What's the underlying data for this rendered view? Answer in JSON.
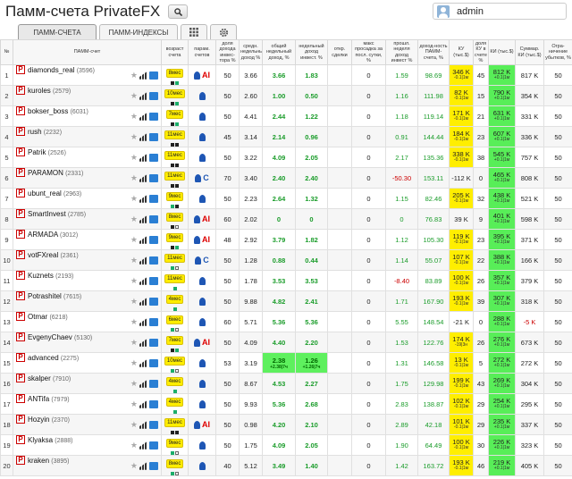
{
  "header": {
    "title": "Памм-счета PrivateFX",
    "user": "admin"
  },
  "tabs": [
    {
      "label": "ПАММ-СЧЕТА",
      "active": true
    },
    {
      "label": "ПАММ-ИНДЕКСЫ",
      "active": false
    }
  ],
  "columns": [
    "№",
    "ПАММ-счет",
    "возраст счета",
    "парам. счетов",
    "доля дохода инвес-тора %",
    "средн. недельный доход %",
    "общий недельный доход, %",
    "недельный доход инвест. %",
    "откр. сделки",
    "макс просадка за посл. сутки, %",
    "прошл. неделя доход инвест %",
    "доход-ность ПАММ-счета, %",
    "КУ (тыс.$)",
    "доля КУ в счете %",
    "КИ (тыс.$)",
    "Суммар. КИ (тыс.$)",
    "Огра-ничение убытков, %"
  ],
  "rows": [
    {
      "n": "1",
      "name": "diamonds_real",
      "id": "(3596)",
      "age": "8мес",
      "sq": [
        "k",
        "g"
      ],
      "ai": "AI",
      "share": "50",
      "avg": "3.66",
      "tot": "3.66",
      "tot_sub": "",
      "inv": "1.83",
      "inv_sub": "",
      "open": "",
      "dd": "0",
      "prev": "1.59",
      "yld": "98.69",
      "ku": "346 K",
      "ku_s": "-0.1|1м",
      "kud": "45",
      "ki": "812 K",
      "ki_s": "+0.1|1м",
      "sum": "817 K",
      "lim": "50"
    },
    {
      "n": "2",
      "name": "kuroles",
      "id": "(2579)",
      "age": "10мес",
      "sq": [
        "k",
        "g"
      ],
      "ai": "",
      "share": "50",
      "avg": "2.60",
      "tot": "1.00",
      "tot_sub": "",
      "inv": "0.50",
      "inv_sub": "",
      "open": "",
      "dd": "0",
      "prev": "1.16",
      "yld": "111.98",
      "ku": "82 K",
      "ku_s": "-0.1|1м",
      "kud": "15",
      "ki": "790 K",
      "ki_s": "+0.1|1м",
      "sum": "354 K",
      "lim": "50"
    },
    {
      "n": "3",
      "name": "bokser_boss",
      "id": "(6031)",
      "age": "7мес",
      "sq": [
        "k",
        "g"
      ],
      "ai": "",
      "share": "50",
      "avg": "4.41",
      "tot": "2.44",
      "tot_sub": "",
      "inv": "1.22",
      "inv_sub": "",
      "open": "",
      "dd": "0",
      "prev": "1.18",
      "yld": "119.14",
      "ku": "171 K",
      "ku_s": "-0.1|1м",
      "kud": "21",
      "ki": "631 K",
      "ki_s": "+0.1|1м",
      "sum": "331 K",
      "lim": "50"
    },
    {
      "n": "4",
      "name": "rush",
      "id": "(2232)",
      "age": "11мес",
      "sq": [
        "k",
        "k"
      ],
      "ai": "",
      "share": "45",
      "avg": "3.14",
      "tot": "2.14",
      "tot_sub": "",
      "inv": "0.96",
      "inv_sub": "",
      "open": "",
      "dd": "0",
      "prev": "0.91",
      "yld": "144.44",
      "ku": "184 K",
      "ku_s": "-0.1|1м",
      "kud": "23",
      "ki": "607 K",
      "ki_s": "+0.1|1м",
      "sum": "336 K",
      "lim": "50"
    },
    {
      "n": "5",
      "name": "Patrik",
      "id": "(2526)",
      "age": "11мес",
      "sq": [
        "k",
        "k"
      ],
      "ai": "",
      "share": "50",
      "avg": "3.22",
      "tot": "4.09",
      "tot_sub": "",
      "inv": "2.05",
      "inv_sub": "",
      "open": "",
      "dd": "0",
      "prev": "2.17",
      "yld": "135.36",
      "ku": "338 K",
      "ku_s": "-0.1|1м",
      "kud": "38",
      "ki": "545 K",
      "ki_s": "+0.1|1м",
      "sum": "757 K",
      "lim": "50"
    },
    {
      "n": "6",
      "name": "PARAMON",
      "id": "(2331)",
      "age": "11мес",
      "sq": [
        "k",
        "k"
      ],
      "ai": "C",
      "share": "70",
      "avg": "3.40",
      "tot": "2.40",
      "tot_sub": "",
      "inv": "2.40",
      "inv_sub": "",
      "open": "",
      "dd": "0",
      "prev": "-50.30",
      "yld": "153.11",
      "ku": "-112 K",
      "ku_s": "",
      "kud": "0",
      "ki": "465 K",
      "ki_s": "+0.1|1м",
      "sum": "808 K",
      "lim": "50"
    },
    {
      "n": "7",
      "name": "ubunt_real",
      "id": "(2963)",
      "age": "9мес",
      "sq": [
        "g",
        "k"
      ],
      "ai": "",
      "share": "50",
      "avg": "2.23",
      "tot": "2.64",
      "tot_sub": "",
      "inv": "1.32",
      "inv_sub": "",
      "open": "",
      "dd": "0",
      "prev": "1.15",
      "yld": "82.46",
      "ku": "205 K",
      "ku_s": "-0.1|1м",
      "kud": "32",
      "ki": "438 K",
      "ki_s": "+0.1|1м",
      "sum": "521 K",
      "lim": "50"
    },
    {
      "n": "8",
      "name": "SmartInvest",
      "id": "(2785)",
      "age": "8мес",
      "sq": [
        "k",
        "w"
      ],
      "ai": "AI",
      "share": "60",
      "avg": "2.02",
      "tot": "0",
      "tot_sub": "",
      "inv": "0",
      "inv_sub": "",
      "open": "",
      "dd": "0",
      "prev": "0",
      "yld": "76.83",
      "ku": "39 K",
      "ku_s": "",
      "kud": "9",
      "ki": "401 K",
      "ki_s": "+0.1|1м",
      "sum": "598 K",
      "lim": "50"
    },
    {
      "n": "9",
      "name": "ARMADA",
      "id": "(3012)",
      "age": "9мес",
      "sq": [
        "k",
        "g"
      ],
      "ai": "AI",
      "share": "48",
      "avg": "2.92",
      "tot": "3.79",
      "tot_sub": "",
      "inv": "1.82",
      "inv_sub": "",
      "open": "",
      "dd": "0",
      "prev": "1.12",
      "yld": "105.30",
      "ku": "119 K",
      "ku_s": "-0.1|1м",
      "kud": "23",
      "ki": "395 K",
      "ki_s": "+0.1|1м",
      "sum": "371 K",
      "lim": "50"
    },
    {
      "n": "10",
      "name": "votFXreal",
      "id": "(2361)",
      "age": "11мес",
      "sq": [
        "g",
        "w"
      ],
      "ai": "C",
      "share": "50",
      "avg": "1.28",
      "tot": "0.88",
      "tot_sub": "",
      "inv": "0.44",
      "inv_sub": "",
      "open": "",
      "dd": "0",
      "prev": "1.14",
      "yld": "55.07",
      "ku": "107 K",
      "ku_s": "-0.1|1м",
      "kud": "22",
      "ki": "388 K",
      "ki_s": "+0.1|1м",
      "sum": "166 K",
      "lim": "50"
    },
    {
      "n": "11",
      "name": "Kuznets",
      "id": "(2193)",
      "age": "11мес",
      "sq": [
        "g"
      ],
      "ai": "",
      "share": "50",
      "avg": "1.78",
      "tot": "3.53",
      "tot_sub": "",
      "inv": "3.53",
      "inv_sub": "",
      "open": "",
      "dd": "0",
      "prev": "-8.40",
      "yld": "83.89",
      "ku": "100 K",
      "ku_s": "-0.1|1м",
      "kud": "26",
      "ki": "357 K",
      "ki_s": "+0.1|1м",
      "sum": "379 K",
      "lim": "50"
    },
    {
      "n": "12",
      "name": "Potrashitel",
      "id": "(7615)",
      "age": "4мес",
      "sq": [
        "g"
      ],
      "ai": "",
      "share": "50",
      "avg": "9.88",
      "tot": "4.82",
      "tot_sub": "",
      "inv": "2.41",
      "inv_sub": "",
      "open": "",
      "dd": "0",
      "prev": "1.71",
      "yld": "167.90",
      "ku": "193 K",
      "ku_s": "-0.1|1м",
      "kud": "39",
      "ki": "307 K",
      "ki_s": "+0.1|1м",
      "sum": "318 K",
      "lim": "50"
    },
    {
      "n": "13",
      "name": "Otmar",
      "id": "(6218)",
      "age": "6мес",
      "sq": [
        "g",
        "w"
      ],
      "ai": "",
      "share": "60",
      "avg": "5.71",
      "tot": "5.36",
      "tot_sub": "",
      "inv": "5.36",
      "inv_sub": "",
      "open": "",
      "dd": "0",
      "prev": "5.55",
      "yld": "148.54",
      "ku": "-21 K",
      "ku_s": "",
      "kud": "0",
      "ki": "288 K",
      "ki_s": "+0.1|1м",
      "sum": "-5 K",
      "lim": "50"
    },
    {
      "n": "14",
      "name": "EvgenyChaev",
      "id": "(5130)",
      "age": "7мес",
      "sq": [
        "k",
        "g"
      ],
      "ai": "AI",
      "share": "50",
      "avg": "4.09",
      "tot": "4.40",
      "tot_sub": "",
      "inv": "2.20",
      "inv_sub": "",
      "open": "",
      "dd": "0",
      "prev": "1.53",
      "yld": "122.76",
      "ku": "174 K",
      "ku_s": "-19|3н",
      "kud": "26",
      "ki": "276 K",
      "ki_s": "+0.1|1м",
      "sum": "673 K",
      "lim": "50"
    },
    {
      "n": "15",
      "name": "advanced",
      "id": "(2275)",
      "age": "10мес",
      "sq": [
        "g",
        "w"
      ],
      "ai": "",
      "share": "53",
      "avg": "3.19",
      "tot": "2.38",
      "tot_sub": "+2.38|7ч",
      "inv": "1.26",
      "inv_sub": "+1.26|7ч",
      "open": "",
      "dd": "0",
      "prev": "1.31",
      "yld": "146.58",
      "ku": "13 K",
      "ku_s": "-0.1|1м",
      "kud": "5",
      "ki": "272 K",
      "ki_s": "+0.1|1м",
      "sum": "272 K",
      "lim": "50"
    },
    {
      "n": "16",
      "name": "skalper",
      "id": "(7910)",
      "age": "4мес",
      "sq": [
        "g"
      ],
      "ai": "",
      "share": "50",
      "avg": "8.67",
      "tot": "4.53",
      "tot_sub": "",
      "inv": "2.27",
      "inv_sub": "",
      "open": "",
      "dd": "0",
      "prev": "1.75",
      "yld": "129.98",
      "ku": "199 K",
      "ku_s": "-0.1|1м",
      "kud": "43",
      "ki": "269 K",
      "ki_s": "+0.1|1м",
      "sum": "304 K",
      "lim": "50"
    },
    {
      "n": "17",
      "name": "ANTifa",
      "id": "(7979)",
      "age": "4мес",
      "sq": [
        "g"
      ],
      "ai": "",
      "share": "50",
      "avg": "9.93",
      "tot": "5.36",
      "tot_sub": "",
      "inv": "2.68",
      "inv_sub": "",
      "open": "",
      "dd": "0",
      "prev": "2.83",
      "yld": "138.87",
      "ku": "102 K",
      "ku_s": "-0.1|1м",
      "kud": "29",
      "ki": "254 K",
      "ki_s": "+0.1|1м",
      "sum": "295 K",
      "lim": "50"
    },
    {
      "n": "18",
      "name": "Hozyin",
      "id": "(2370)",
      "age": "11мес",
      "sq": [
        "k",
        "k"
      ],
      "ai": "AI",
      "share": "50",
      "avg": "0.98",
      "tot": "4.20",
      "tot_sub": "",
      "inv": "2.10",
      "inv_sub": "",
      "open": "",
      "dd": "0",
      "prev": "2.89",
      "yld": "42.18",
      "ku": "101 K",
      "ku_s": "-0.1|1м",
      "kud": "29",
      "ki": "235 K",
      "ki_s": "+0.1|1м",
      "sum": "337 K",
      "lim": "50"
    },
    {
      "n": "19",
      "name": "Klyaksa",
      "id": "(2888)",
      "age": "9мес",
      "sq": [
        "g",
        "w"
      ],
      "ai": "",
      "share": "50",
      "avg": "1.75",
      "tot": "4.09",
      "tot_sub": "",
      "inv": "2.05",
      "inv_sub": "",
      "open": "",
      "dd": "0",
      "prev": "1.90",
      "yld": "64.49",
      "ku": "100 K",
      "ku_s": "-0.1|1м",
      "kud": "30",
      "ki": "226 K",
      "ki_s": "+0.1|1м",
      "sum": "323 K",
      "lim": "50"
    },
    {
      "n": "20",
      "name": "kraken",
      "id": "(3895)",
      "age": "8мес",
      "sq": [
        "g",
        "w"
      ],
      "ai": "",
      "share": "40",
      "avg": "5.12",
      "tot": "3.49",
      "tot_sub": "",
      "inv": "1.40",
      "inv_sub": "",
      "open": "",
      "dd": "0",
      "prev": "1.42",
      "yld": "163.72",
      "ku": "193 K",
      "ku_s": "-0.1|1м",
      "kud": "46",
      "ki": "219 K",
      "ki_s": "+0.1|1м",
      "sum": "405 K",
      "lim": "50"
    }
  ]
}
